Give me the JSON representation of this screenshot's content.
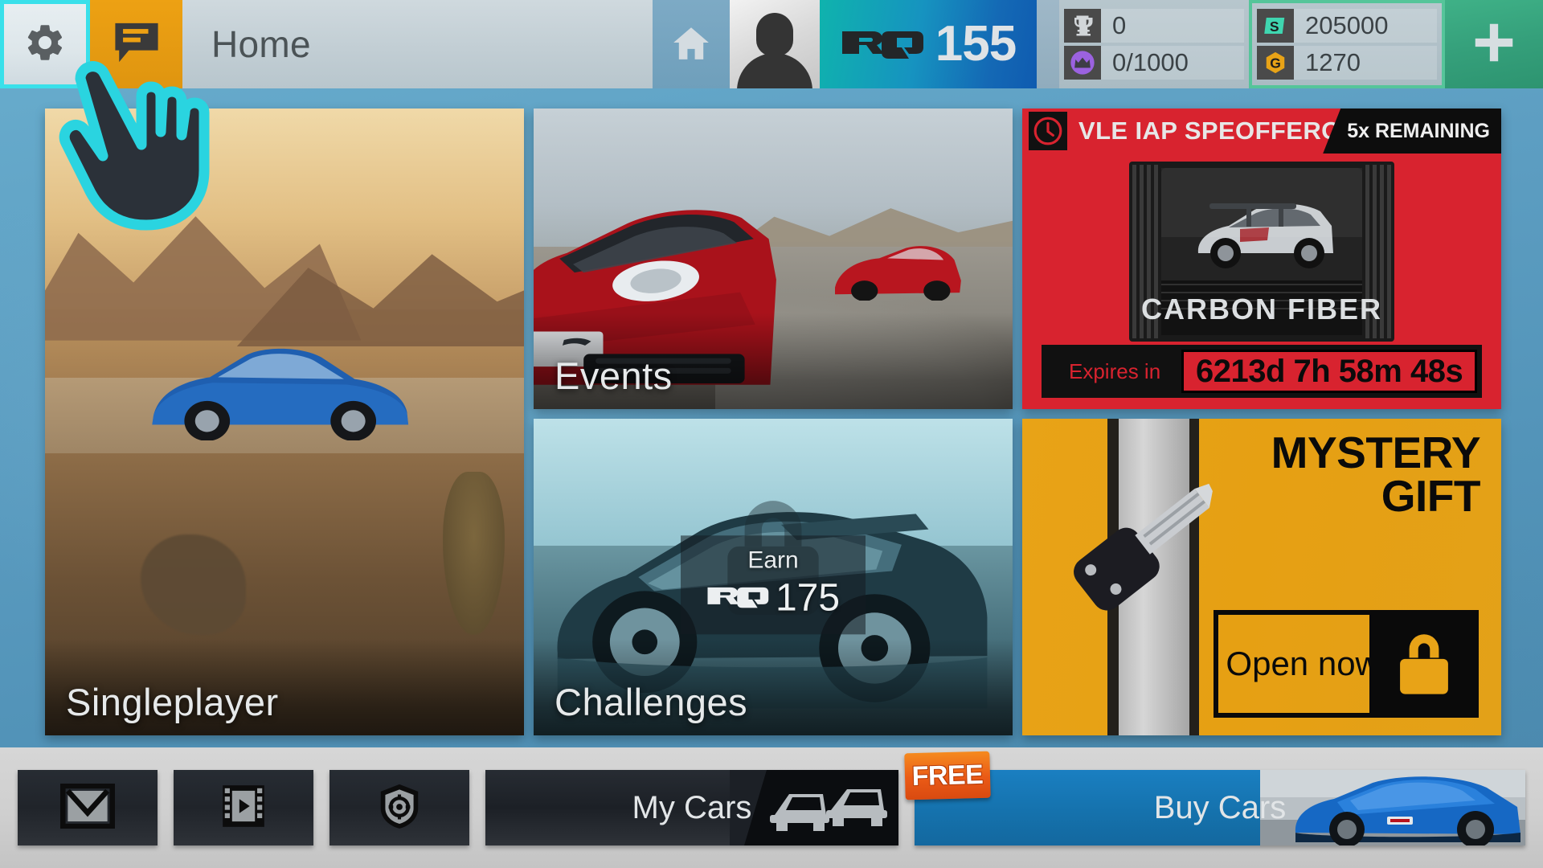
{
  "topbar": {
    "settings_icon": "gear-icon",
    "chat_icon": "chat-bubble-icon",
    "title": "Home",
    "home_icon": "home-icon",
    "avatar_icon": "avatar-silhouette-icon",
    "rq_logo": "RQ",
    "rq_value": "155",
    "stats": [
      {
        "icon": "trophy-icon",
        "value": "0"
      },
      {
        "icon": "crown-badge-icon",
        "value": "0/1000"
      },
      {
        "icon": "cash-icon",
        "value": "205000"
      },
      {
        "icon": "gold-icon",
        "value": "1270"
      }
    ],
    "add_label": "+",
    "colors": {
      "chat_orange": "#eda113",
      "rq_teal": "#0fb3ad",
      "rq_blue": "#0f5bb0",
      "money_border": "#55c59a",
      "add_green": "#35a07b",
      "settings_highlight": "#39e0ea"
    }
  },
  "cursor": {
    "icon": "pointing-hand-cursor-icon",
    "outline_color": "#2ad4e0"
  },
  "tiles": {
    "singleplayer": {
      "label": "Singleplayer"
    },
    "events": {
      "label": "Events"
    },
    "challenges": {
      "label": "Challenges",
      "badge": {
        "earn_label": "Earn",
        "rq_logo": "RQ",
        "rq_value": "175",
        "lock_icon": "padlock-icon"
      }
    },
    "offer": {
      "clock_icon": "clock-icon",
      "title": "VLE IAP SPEOFFEROFFER",
      "remaining": "5x REMAINING",
      "pack_label": "CARBON FIBER",
      "expires_label": "Expires in",
      "expires_value": "6213d 7h 58m 48s",
      "colors": {
        "red": "#d8232f",
        "black": "#0d0d0d"
      }
    },
    "mystery_gift": {
      "title_line1": "MYSTERY",
      "title_line2": "GIFT",
      "button_label": "Open now!",
      "lock_icon": "padlock-icon",
      "key_icon": "car-key-icon",
      "colors": {
        "amber": "#e8a317",
        "black": "#0a0a0a"
      }
    }
  },
  "bottombar": {
    "buttons": [
      {
        "icon": "mail-envelope-icon",
        "label": ""
      },
      {
        "icon": "film-strip-play-icon",
        "label": ""
      },
      {
        "icon": "shield-target-icon",
        "label": ""
      }
    ],
    "my_cars": {
      "label": "My Cars",
      "icon": "two-cars-icon"
    },
    "buy_cars": {
      "label": "Buy Cars",
      "badge": "FREE",
      "icon": "blue-supercar-image"
    },
    "colors": {
      "buy_blue": "#1a7fc1",
      "free_orange": "#ea5a16"
    }
  }
}
